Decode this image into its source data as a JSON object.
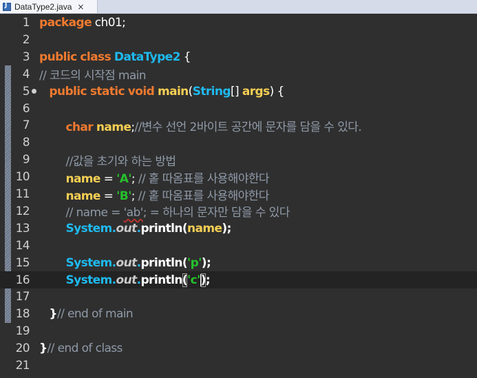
{
  "tab": {
    "title": "DataType2.java",
    "icon": "java-file-icon",
    "close_glyph": "×"
  },
  "colors": {
    "background": "#2f2f2f",
    "keyword": "#f07a2f",
    "type": "#1ebaf0",
    "identifier": "#f5cf53",
    "comment": "#8f9aa8",
    "string": "#26c12c"
  },
  "lines": [
    {
      "n": "1",
      "parts": [
        [
          "kw",
          "package"
        ],
        [
          "plain",
          " ch01;"
        ]
      ]
    },
    {
      "n": "2",
      "parts": []
    },
    {
      "n": "3",
      "parts": [
        [
          "kw",
          "public"
        ],
        [
          "plain",
          " "
        ],
        [
          "kw",
          "class"
        ],
        [
          "plain",
          " "
        ],
        [
          "ty",
          "DataType2"
        ],
        [
          "plain",
          " {"
        ]
      ]
    },
    {
      "n": "4",
      "parts": [
        [
          "cmt",
          "// 코드의 시작점 main"
        ]
      ]
    },
    {
      "n": "5",
      "parts": [
        [
          "plain",
          "   "
        ],
        [
          "kw",
          "public"
        ],
        [
          "plain",
          " "
        ],
        [
          "kw",
          "static"
        ],
        [
          "plain",
          " "
        ],
        [
          "kw",
          "void"
        ],
        [
          "plain",
          " "
        ],
        [
          "ident",
          "main"
        ],
        [
          "plain",
          "("
        ],
        [
          "ty",
          "String"
        ],
        [
          "plain",
          "[] "
        ],
        [
          "ident",
          "args"
        ],
        [
          "plain",
          ") {"
        ]
      ]
    },
    {
      "n": "6",
      "parts": []
    },
    {
      "n": "7",
      "parts": [
        [
          "plain",
          "        "
        ],
        [
          "kw",
          "char"
        ],
        [
          "plain",
          " "
        ],
        [
          "ident",
          "name"
        ],
        [
          "plain",
          ";"
        ],
        [
          "cmt",
          "//변수 선언 2바이트 공간에 문자를 담을 수 있다."
        ]
      ]
    },
    {
      "n": "8",
      "parts": []
    },
    {
      "n": "9",
      "parts": [
        [
          "plain",
          "        "
        ],
        [
          "cmt",
          "//값을 초기와 하는 방법"
        ]
      ]
    },
    {
      "n": "10",
      "parts": [
        [
          "plain",
          "        "
        ],
        [
          "ident",
          "name"
        ],
        [
          "plain",
          " = "
        ],
        [
          "str",
          "'A'"
        ],
        [
          "plain",
          "; "
        ],
        [
          "cmt",
          "// 홑 따옴표를 사용해야한다"
        ]
      ]
    },
    {
      "n": "11",
      "parts": [
        [
          "plain",
          "        "
        ],
        [
          "ident",
          "name"
        ],
        [
          "plain",
          " = "
        ],
        [
          "str",
          "'B'"
        ],
        [
          "plain",
          "; "
        ],
        [
          "cmt",
          "// 홑 따옴표를 사용해야한다"
        ]
      ]
    },
    {
      "n": "12",
      "parts": [
        [
          "plain",
          "        "
        ],
        [
          "cmt",
          "// name = "
        ],
        [
          "cmtsq",
          "'ab'"
        ],
        [
          "cmt",
          "; = 하나의 문자만 담을 수 있다"
        ]
      ]
    },
    {
      "n": "13",
      "parts": [
        [
          "plain",
          "        "
        ],
        [
          "ty",
          "System."
        ],
        [
          "field",
          "out"
        ],
        [
          "ty",
          "."
        ],
        [
          "plainb",
          "println("
        ],
        [
          "ident",
          "name"
        ],
        [
          "plainb",
          ");"
        ]
      ]
    },
    {
      "n": "14",
      "parts": []
    },
    {
      "n": "15",
      "parts": [
        [
          "plain",
          "        "
        ],
        [
          "ty",
          "System."
        ],
        [
          "field",
          "out"
        ],
        [
          "ty",
          "."
        ],
        [
          "plainb",
          "println("
        ],
        [
          "str",
          "'p'"
        ],
        [
          "plainb",
          ");"
        ]
      ]
    },
    {
      "n": "16",
      "parts": [
        [
          "plain",
          "        "
        ],
        [
          "ty",
          "System."
        ],
        [
          "field",
          "out"
        ],
        [
          "ty",
          "."
        ],
        [
          "plainb",
          "println"
        ],
        [
          "box",
          "("
        ],
        [
          "str",
          "'c'"
        ],
        [
          "caret",
          ""
        ],
        [
          "box",
          ")"
        ],
        [
          "plainb",
          ";"
        ]
      ]
    },
    {
      "n": "17",
      "parts": []
    },
    {
      "n": "18",
      "parts": [
        [
          "plain",
          "   "
        ],
        [
          "plainb",
          "}"
        ],
        [
          "cmt",
          "// end of main"
        ]
      ]
    },
    {
      "n": "19",
      "parts": []
    },
    {
      "n": "20",
      "parts": [
        [
          "plainb",
          "}"
        ],
        [
          "cmt",
          "// end of class"
        ]
      ]
    },
    {
      "n": "21",
      "parts": []
    }
  ]
}
